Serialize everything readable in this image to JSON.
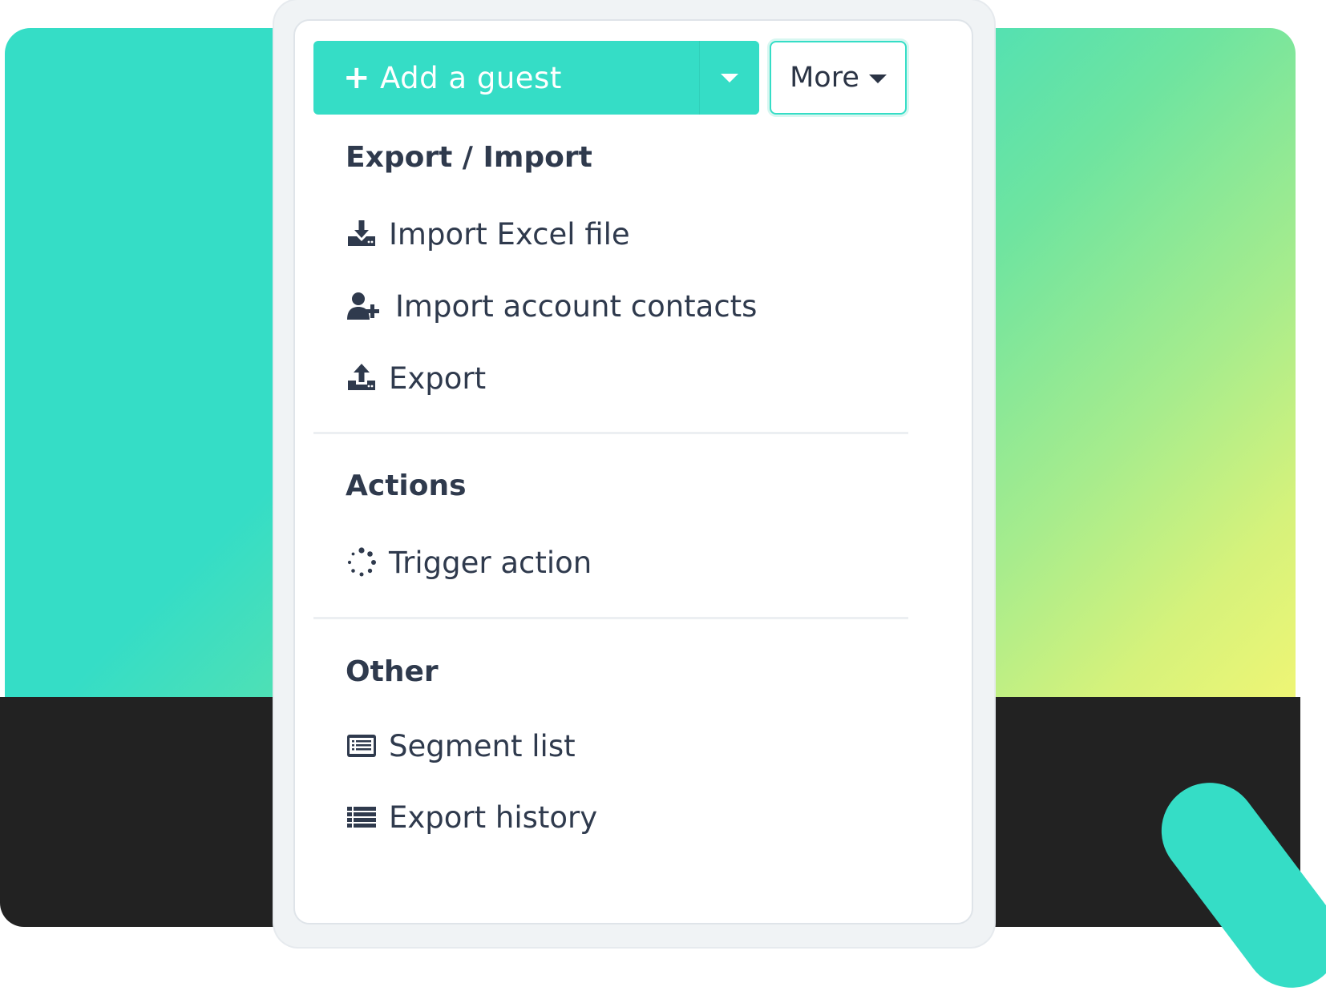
{
  "toolbar": {
    "add_guest_label": "Add a guest",
    "add_guest_plus": "+",
    "more_label": "More"
  },
  "menu": {
    "sections": [
      {
        "header": "Export / Import",
        "items": [
          {
            "label": "Import Excel file",
            "icon": "download-tray-icon"
          },
          {
            "label": "Import account contacts",
            "icon": "user-plus-icon"
          },
          {
            "label": "Export",
            "icon": "upload-tray-icon"
          }
        ]
      },
      {
        "header": "Actions",
        "items": [
          {
            "label": "Trigger action",
            "icon": "spinner-icon"
          }
        ]
      },
      {
        "header": "Other",
        "items": [
          {
            "label": "Segment list",
            "icon": "list-card-icon"
          },
          {
            "label": "Export history",
            "icon": "list-icon"
          }
        ]
      }
    ]
  },
  "colors": {
    "accent": "#35ddc6",
    "text": "#2f3a4d",
    "dark_band": "#222222",
    "gradient_end": "#f5f673"
  }
}
